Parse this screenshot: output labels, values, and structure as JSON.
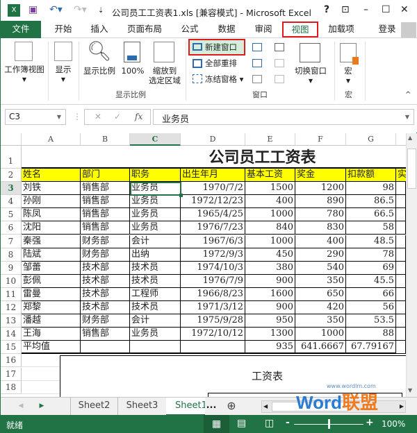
{
  "title_bar": {
    "title": "公司员工工资表1.xls  [兼容模式] - Microsoft Excel",
    "help": "?",
    "icons": [
      "excel-logo-icon",
      "save-icon",
      "undo-icon",
      "redo-icon",
      "customize-icon",
      "ribbon-display-icon",
      "minimize-icon",
      "maximize-icon",
      "close-icon"
    ]
  },
  "tabs": [
    {
      "label": "文件"
    },
    {
      "label": "开始"
    },
    {
      "label": "插入"
    },
    {
      "label": "页面布局"
    },
    {
      "label": "公式"
    },
    {
      "label": "数据"
    },
    {
      "label": "审阅"
    },
    {
      "label": "视图",
      "active": true
    },
    {
      "label": "加载项"
    }
  ],
  "account": {
    "login": "登录"
  },
  "ribbon": {
    "workbook_views": "工作簿视图",
    "show": "显示",
    "zoom": "显示比例",
    "zoom100": "100%",
    "zoom_sel": "缩放到选定区域",
    "zoom_sel_l1": "缩放到",
    "zoom_sel_l2": "选定区域",
    "new_window": "新建窗口",
    "arrange_all": "全部重排",
    "freeze": "冻结窗格",
    "switch_windows": "切换窗口",
    "macros": "宏",
    "groups": {
      "zoom": "显示比例",
      "window": "窗口",
      "macros": "宏"
    },
    "highlight_color": "#e0191d"
  },
  "formula_bar": {
    "name_box": "C3",
    "cancel": "✕",
    "enter": "✓",
    "fx": "fx",
    "value": "业务员"
  },
  "columns": [
    "A",
    "B",
    "C",
    "D",
    "E",
    "F",
    "G"
  ],
  "selected_cell": "C3",
  "sheet": {
    "title": "公司员工工资表",
    "header": [
      "姓名",
      "部门",
      "职务",
      "出生年月",
      "基本工资",
      "奖金",
      "扣款额",
      "实"
    ],
    "rows": [
      [
        "刘铁",
        "销售部",
        "业务员",
        "1970/7/2",
        "1500",
        "1200",
        "98"
      ],
      [
        "孙刚",
        "销售部",
        "业务员",
        "1972/12/23",
        "400",
        "890",
        "86.5"
      ],
      [
        "陈凤",
        "销售部",
        "业务员",
        "1965/4/25",
        "1000",
        "780",
        "66.5"
      ],
      [
        "沈阳",
        "销售部",
        "业务员",
        "1976/7/23",
        "840",
        "830",
        "58"
      ],
      [
        "秦强",
        "财务部",
        "会计",
        "1967/6/3",
        "1000",
        "400",
        "48.5"
      ],
      [
        "陆斌",
        "财务部",
        "出纳",
        "1972/9/3",
        "450",
        "290",
        "78"
      ],
      [
        "邹蕾",
        "技术部",
        "技术员",
        "1974/10/3",
        "380",
        "540",
        "69"
      ],
      [
        "彭佩",
        "技术部",
        "技术员",
        "1976/7/9",
        "900",
        "350",
        "45.5"
      ],
      [
        "雷曼",
        "技术部",
        "工程师",
        "1966/8/23",
        "1600",
        "650",
        "66"
      ],
      [
        "郑黎",
        "技术部",
        "技术员",
        "1971/3/12",
        "900",
        "420",
        "56"
      ],
      [
        "潘越",
        "财务部",
        "会计",
        "1975/9/28",
        "950",
        "350",
        "53.5"
      ],
      [
        "王海",
        "销售部",
        "业务员",
        "1972/10/12",
        "1300",
        "1000",
        "88"
      ]
    ],
    "average": [
      "平均值",
      "",
      "",
      "",
      "935",
      "641.6667",
      "67.79167"
    ],
    "header_fill": "#ffff00",
    "chart_title": "工资表"
  },
  "row_numbers": [
    "1",
    "2",
    "3",
    "4",
    "5",
    "6",
    "7",
    "8",
    "9",
    "10",
    "11",
    "12",
    "13",
    "14",
    "15",
    "16",
    "17",
    "18"
  ],
  "sheet_tabs": [
    {
      "label": "Sheet2"
    },
    {
      "label": "Sheet3"
    },
    {
      "label": "Sheet1",
      "active": true
    }
  ],
  "sheet_more": "...",
  "watermark": {
    "url": "www.wordlm.com",
    "text": "Word联盟"
  },
  "status": {
    "ready": "就绪",
    "zoom": "100%",
    "zoom_level_percent": 100,
    "accent": "#217346"
  }
}
